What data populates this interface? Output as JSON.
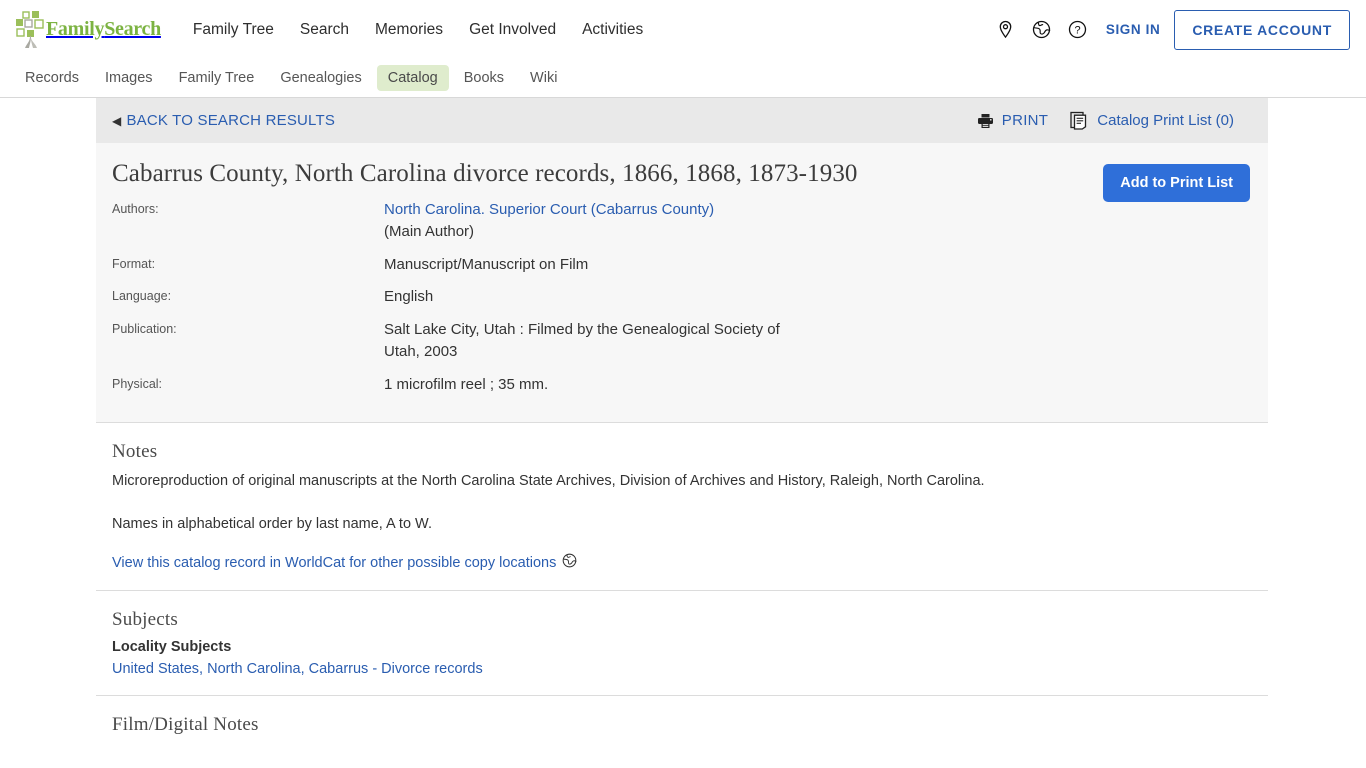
{
  "header": {
    "logo_text_family": "Family",
    "logo_text_search": "Search",
    "nav": [
      {
        "label": "Family Tree"
      },
      {
        "label": "Search"
      },
      {
        "label": "Memories"
      },
      {
        "label": "Get Involved"
      },
      {
        "label": "Activities"
      }
    ],
    "icons": [
      {
        "name": "location-pin-icon"
      },
      {
        "name": "globe-icon"
      },
      {
        "name": "help-circle-icon"
      }
    ],
    "sign_in_label": "SIGN IN",
    "create_account_label": "CREATE ACCOUNT"
  },
  "subnav": {
    "items": [
      {
        "label": "Records",
        "active": false
      },
      {
        "label": "Images",
        "active": false
      },
      {
        "label": "Family Tree",
        "active": false
      },
      {
        "label": "Genealogies",
        "active": false
      },
      {
        "label": "Catalog",
        "active": true
      },
      {
        "label": "Books",
        "active": false
      },
      {
        "label": "Wiki",
        "active": false
      }
    ],
    "active_bg": "#dfeccd"
  },
  "breadcrumb": {
    "back_label": "BACK TO SEARCH RESULTS",
    "back_arrow": "◀",
    "print_label": "PRINT",
    "catalog_print_list_label": "Catalog Print List (0)"
  },
  "record": {
    "title": "Cabarrus County, North Carolina divorce records, 1866, 1868, 1873-1930",
    "add_to_print_list_label": "Add to Print List",
    "fields": [
      {
        "label": "Authors:",
        "value_link": "North Carolina. Superior Court (Cabarrus County)",
        "value_sub": "(Main Author)"
      },
      {
        "label": "Format:",
        "value": "Manuscript/Manuscript on Film"
      },
      {
        "label": "Language:",
        "value": "English"
      },
      {
        "label": "Publication:",
        "value": "Salt Lake City, Utah : Filmed by the Genealogical Society of Utah, 2003"
      },
      {
        "label": "Physical:",
        "value": "1 microfilm reel ; 35 mm."
      }
    ]
  },
  "notes": {
    "title": "Notes",
    "line1": "Microreproduction of original manuscripts at the North Carolina State Archives, Division of Archives and History, Raleigh, North Carolina.",
    "line2": "Names in alphabetical order by last name, A to W.",
    "worldcat_link": "View this catalog record in WorldCat for other possible copy locations"
  },
  "subjects": {
    "title": "Subjects",
    "group_title": "Locality Subjects",
    "links": [
      "United States, North Carolina, Cabarrus - Divorce records"
    ]
  },
  "film_notes": {
    "title": "Film/Digital Notes"
  },
  "colors": {
    "link_blue": "#2a5db0",
    "button_blue": "#2f6fd9",
    "brand_green": "#7cb342",
    "bar_gray": "#e9e9e9",
    "panel_gray": "#f7f7f7"
  }
}
